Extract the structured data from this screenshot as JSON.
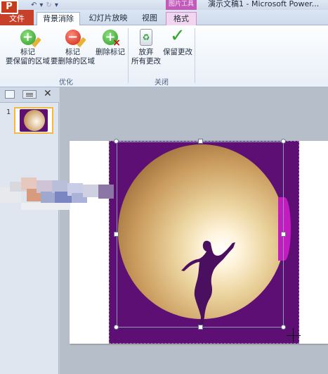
{
  "title_bar": {
    "context_group": "图片工具",
    "document_title": "演示文稿1 - Microsoft Power..."
  },
  "tabs": [
    {
      "label": "文件"
    },
    {
      "label": "背景消除"
    },
    {
      "label": "幻灯片放映"
    },
    {
      "label": "视图"
    },
    {
      "label": "格式"
    }
  ],
  "ribbon": {
    "mark_keep": {
      "line1": "标记",
      "line2": "要保留的区域",
      "icon": "plus-pencil-icon"
    },
    "mark_remove": {
      "line1": "标记",
      "line2": "要删除的区域",
      "icon": "minus-pencil-icon"
    },
    "delete_mark": {
      "line1": "删除标记",
      "icon": "delete-mark-icon"
    },
    "group_refine": "优化",
    "discard": {
      "line1": "放弃",
      "line2": "所有更改",
      "icon": "recycle-bin-icon"
    },
    "keep_changes": {
      "line1": "保留更改",
      "icon": "check-icon"
    },
    "group_close": "关闭"
  },
  "left_pane": {
    "close_glyph": "✕",
    "slides": [
      {
        "number": "1"
      }
    ]
  },
  "colors": {
    "file_tab": "#c6402a",
    "context_tab": "#c25ab9",
    "image_background": "#5d0f73",
    "selection_thumb_border": "#f4b942"
  }
}
